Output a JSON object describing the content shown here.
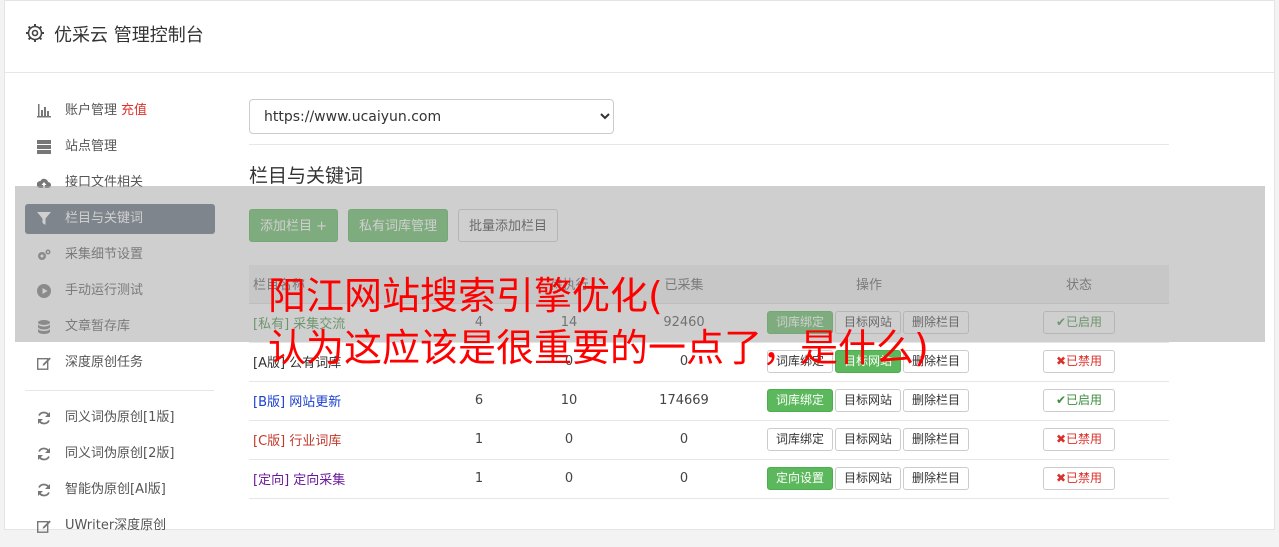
{
  "header": {
    "title": "优采云 管理控制台"
  },
  "sidebar": {
    "items": [
      {
        "label": "账户管理",
        "extra": "充值",
        "icon": "bar-chart-icon"
      },
      {
        "label": "站点管理",
        "icon": "server-icon"
      },
      {
        "label": "接口文件相关",
        "icon": "cloud-upload-icon"
      },
      {
        "label": "栏目与关键词",
        "icon": "filter-icon",
        "active": true
      },
      {
        "label": "采集细节设置",
        "icon": "cogs-icon"
      },
      {
        "label": "手动运行测试",
        "icon": "play-circle-icon"
      },
      {
        "label": "文章暂存库",
        "icon": "database-icon"
      },
      {
        "label": "深度原创任务",
        "icon": "edit-icon"
      }
    ],
    "items2": [
      {
        "label": "同义词伪原创[1版]",
        "icon": "refresh-icon"
      },
      {
        "label": "同义词伪原创[2版]",
        "icon": "refresh-icon"
      },
      {
        "label": "智能伪原创[AI版]",
        "icon": "refresh-icon"
      },
      {
        "label": "UWriter深度原创",
        "icon": "edit-icon"
      }
    ]
  },
  "main": {
    "site_select": "https://www.ucaiyun.com",
    "section_title": "栏目与关键词",
    "buttons": {
      "add_column": "添加栏目 +",
      "private_lib": "私有词库管理",
      "batch_add": "批量添加栏目"
    },
    "table": {
      "headers": [
        "栏目名称",
        "",
        "待执行",
        "已采集",
        "操作",
        "状态"
      ],
      "rows": [
        {
          "tag": "[私有]",
          "name": "采集交流",
          "c1": "4",
          "c2": "14",
          "c3": "92460",
          "op1": "词库绑定",
          "op2": "目标网站",
          "op3": "删除栏目",
          "status": "✔已启用",
          "on": true
        },
        {
          "tag": "[A版]",
          "name": "公有词库",
          "c1": "",
          "c2": "0",
          "c3": "0",
          "op1": "词库绑定",
          "op2": "目标网站",
          "op3": "删除栏目",
          "status": "✖已禁用",
          "on": false
        },
        {
          "tag": "[B版]",
          "name": "网站更新",
          "c1": "6",
          "c2": "10",
          "c3": "174669",
          "op1": "词库绑定",
          "op2": "目标网站",
          "op3": "删除栏目",
          "status": "✔已启用",
          "on": true
        },
        {
          "tag": "[C版]",
          "name": "行业词库",
          "c1": "1",
          "c2": "0",
          "c3": "0",
          "op1": "词库绑定",
          "op2": "目标网站",
          "op3": "删除栏目",
          "status": "✖已禁用",
          "on": false
        },
        {
          "tag": "[定向]",
          "name": "定向采集",
          "c1": "1",
          "c2": "0",
          "c3": "0",
          "op1": "定向设置",
          "op2": "目标网站",
          "op3": "删除栏目",
          "status": "✖已禁用",
          "on": false
        }
      ]
    }
  },
  "overlay": {
    "line1": "阳江网站搜索引擎优化(",
    "line2": "认为这应该是很重要的一点了，是什么)"
  },
  "colors": {
    "green": "#5cb85c",
    "active_nav": "#5f6b7a",
    "ad_red": "#ff0000"
  }
}
